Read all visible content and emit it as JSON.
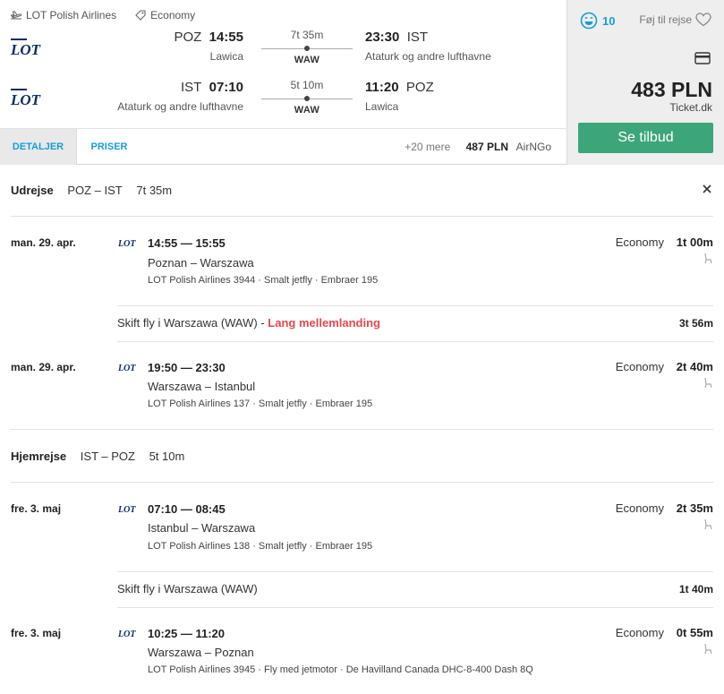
{
  "header": {
    "airline": "LOT Polish Airlines",
    "cabin": "Economy",
    "outbound": {
      "dep_code": "POZ",
      "dep_time": "14:55",
      "dep_airport": "Lawica",
      "duration": "7t 35m",
      "via": "WAW",
      "arr_time": "23:30",
      "arr_code": "IST",
      "arr_airport": "Ataturk og andre lufthavne"
    },
    "return": {
      "dep_code": "IST",
      "dep_time": "07:10",
      "dep_airport": "Ataturk og andre lufthavne",
      "duration": "5t 10m",
      "via": "WAW",
      "arr_time": "11:20",
      "arr_code": "POZ",
      "arr_airport": "Lawica"
    },
    "tabs": [
      "DETALJER",
      "PRISER"
    ],
    "more_offers": "+20 mere",
    "alt_price": "487 PLN",
    "alt_provider": "AirNGo",
    "rating": "10",
    "fav_label": "Føj til rejse",
    "price": "483 PLN",
    "provider": "Ticket.dk",
    "deal_button": "Se tilbud"
  },
  "outbound_section": {
    "title": "Udrejse",
    "route": "POZ – IST",
    "duration": "7t 35m",
    "segments": [
      {
        "date": "man. 29. apr.",
        "times": "14:55 — 15:55",
        "route": "Poznan – Warszawa",
        "info": "LOT Polish Airlines 3944 · Smalt jetfly · Embraer 195",
        "cabin": "Economy",
        "duration": "1t 00m"
      },
      {
        "date": "man. 29. apr.",
        "times": "19:50 — 23:30",
        "route": "Warszawa – Istanbul",
        "info": "LOT Polish Airlines 137 · Smalt jetfly · Embraer 195",
        "cabin": "Economy",
        "duration": "2t 40m"
      }
    ],
    "layover": {
      "text": "Skift fly i Warszawa (WAW)",
      "sep": " - ",
      "warning": "Lang mellemlanding",
      "duration": "3t 56m"
    }
  },
  "return_section": {
    "title": "Hjemrejse",
    "route": "IST – POZ",
    "duration": "5t 10m",
    "segments": [
      {
        "date": "fre. 3. maj",
        "times": "07:10 — 08:45",
        "route": "Istanbul – Warszawa",
        "info": "LOT Polish Airlines 138 · Smalt jetfly · Embraer 195",
        "cabin": "Economy",
        "duration": "2t 35m"
      },
      {
        "date": "fre. 3. maj",
        "times": "10:25 — 11:20",
        "route": "Warszawa – Poznan",
        "info": "LOT Polish Airlines 3945 · Fly med jetmotor · De Havilland Canada DHC-8-400 Dash 8Q",
        "cabin": "Economy",
        "duration": "0t 55m"
      }
    ],
    "layover": {
      "text": "Skift fly i Warszawa (WAW)",
      "duration": "1t 40m"
    }
  },
  "colors": {
    "accent": "#1a9bd7",
    "deal": "#3da57a",
    "warning": "#e5484d",
    "logo": "#0b2a6b"
  }
}
